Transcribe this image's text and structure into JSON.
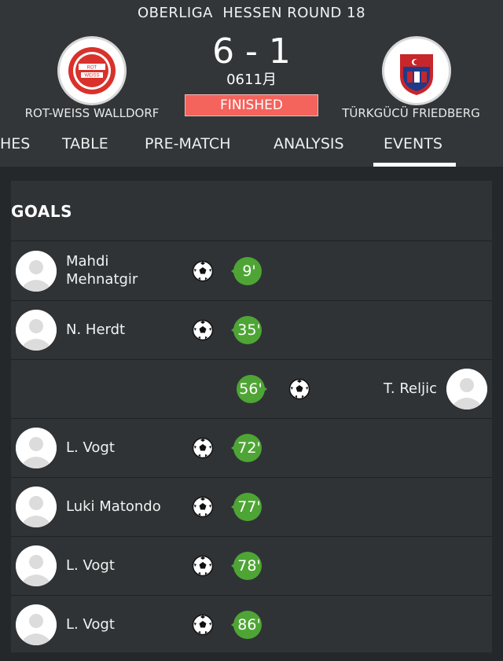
{
  "match": {
    "league": "OBERLIGA  HESSEN ROUND 18",
    "score": "6 - 1",
    "date": "0611月",
    "status": "FINISHED",
    "home": {
      "name": "ROT-WEISS WALLDORF",
      "crest_text": "ROT WEISS"
    },
    "away": {
      "name": "TÜRKGÜCÜ FRIEDBERG",
      "crest_text": "TÜRK GÜCÜ"
    }
  },
  "tabs": [
    {
      "label": "HES"
    },
    {
      "label": "TABLE"
    },
    {
      "label": "PRE-MATCH"
    },
    {
      "label": "ANALYSIS"
    },
    {
      "label": "EVENTS",
      "active": true
    }
  ],
  "goals": {
    "title": "GOALS",
    "events": [
      {
        "side": "home",
        "player": "Mahdi Mehnatgir",
        "minute": "9'"
      },
      {
        "side": "home",
        "player": "N. Herdt",
        "minute": "35'"
      },
      {
        "side": "away",
        "player": "T. Reljic",
        "minute": "56'"
      },
      {
        "side": "home",
        "player": "L. Vogt",
        "minute": "72'"
      },
      {
        "side": "home",
        "player": "Luki Matondo",
        "minute": "77'"
      },
      {
        "side": "home",
        "player": "L. Vogt",
        "minute": "78'"
      },
      {
        "side": "home",
        "player": "L. Vogt",
        "minute": "86'"
      }
    ]
  },
  "colors": {
    "header_bg": "#323639",
    "page_bg": "#24282b",
    "card_bg": "#2f3336",
    "status_red": "#f4635c",
    "minute_green": "#4ea535"
  },
  "icons": {
    "goal": "soccer-ball-icon",
    "avatar": "player-silhouette-icon"
  }
}
